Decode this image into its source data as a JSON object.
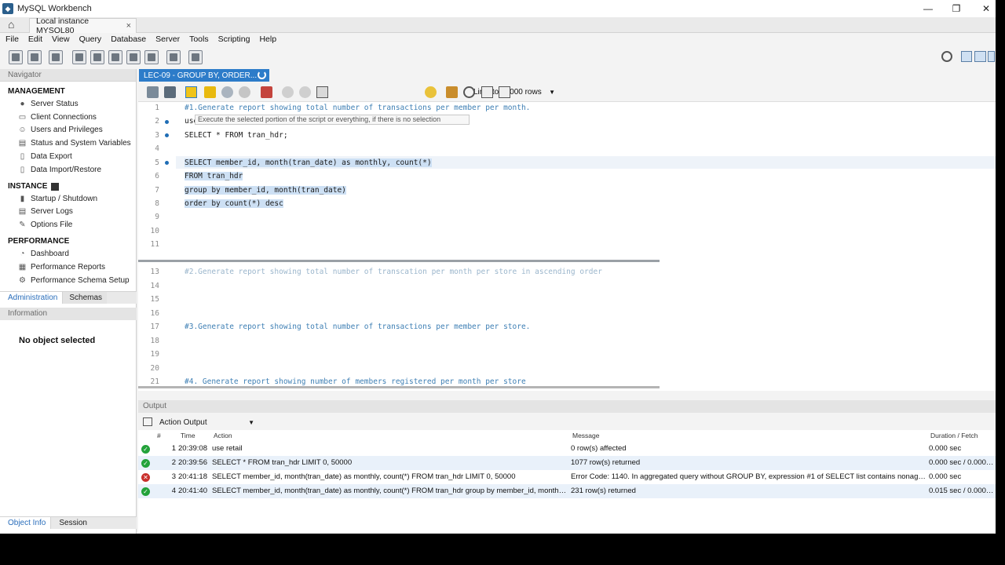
{
  "window": {
    "title": "MySQL Workbench",
    "minimize": "—",
    "maximize": "❐",
    "close": "✕"
  },
  "connection_tab": {
    "label": "Local instance MYSQL80",
    "close": "×"
  },
  "menu": [
    "File",
    "Edit",
    "View",
    "Query",
    "Database",
    "Server",
    "Tools",
    "Scripting",
    "Help"
  ],
  "sidebar": {
    "navigator": "Navigator",
    "management": {
      "title": "MANAGEMENT",
      "items": [
        "Server Status",
        "Client Connections",
        "Users and Privileges",
        "Status and System Variables",
        "Data Export",
        "Data Import/Restore"
      ]
    },
    "instance": {
      "title": "INSTANCE",
      "items": [
        "Startup / Shutdown",
        "Server Logs",
        "Options File"
      ]
    },
    "performance": {
      "title": "PERFORMANCE",
      "items": [
        "Dashboard",
        "Performance Reports",
        "Performance Schema Setup"
      ]
    },
    "tabs": [
      "Administration",
      "Schemas"
    ],
    "information": "Information",
    "no_object": "No object selected",
    "bottom_tabs": [
      "Object Info",
      "Session"
    ]
  },
  "editor": {
    "tab_label": "LEC-09 - GROUP BY, ORDER...",
    "limit_label": "Limit to 50000 rows",
    "tooltip": "Execute the selected portion of the script or everything, if there is no selection",
    "line_numbers": [
      "1",
      "2",
      "3",
      "4",
      "5",
      "6",
      "7",
      "8",
      "9",
      "10",
      "11",
      "13",
      "14",
      "15",
      "16",
      "17",
      "18",
      "19",
      "20",
      "21"
    ],
    "lines": {
      "l1": "#1.Generate report showing total number of transactions per member per month.",
      "l2": "use retail;",
      "l3": "SELECT * FROM tran_hdr;",
      "l5": "SELECT member_id, month(tran_date) as monthly, count(*)",
      "l6": "FROM tran_hdr",
      "l7": "group by member_id, month(tran_date)",
      "l8": "order by count(*) desc",
      "l13": "#2.Generate report showing total number of transcation per month per store in ascending order",
      "l17": "#3.Generate report showing total number of transactions per member per store.",
      "l21": "#4. Generate report showing number of members registered per month per store"
    }
  },
  "output": {
    "title": "Output",
    "selector": "Action Output",
    "columns": [
      "#",
      "Time",
      "Action",
      "Message",
      "Duration / Fetch"
    ],
    "rows": [
      {
        "status": "ok",
        "num": "1",
        "time": "20:39:08",
        "action": "use retail",
        "message": "0 row(s) affected",
        "duration": "0.000 sec"
      },
      {
        "status": "ok",
        "num": "2",
        "time": "20:39:56",
        "action": "SELECT * FROM tran_hdr LIMIT 0, 50000",
        "message": "1077 row(s) returned",
        "duration": "0.000 sec / 0.000 sec"
      },
      {
        "status": "error",
        "num": "3",
        "time": "20:41:18",
        "action": "SELECT member_id, month(tran_date) as monthly, count(*) FROM tran_hdr LIMIT 0, 50000",
        "message": "Error Code: 1140. In aggregated query without GROUP BY, expression #1 of SELECT list contains nonaggregat...",
        "duration": "0.000 sec"
      },
      {
        "status": "ok",
        "num": "4",
        "time": "20:41:40",
        "action": "SELECT member_id, month(tran_date) as monthly, count(*) FROM tran_hdr group by member_id, month(tran_dat...",
        "message": "231 row(s) returned",
        "duration": "0.015 sec / 0.000 sec"
      }
    ]
  }
}
